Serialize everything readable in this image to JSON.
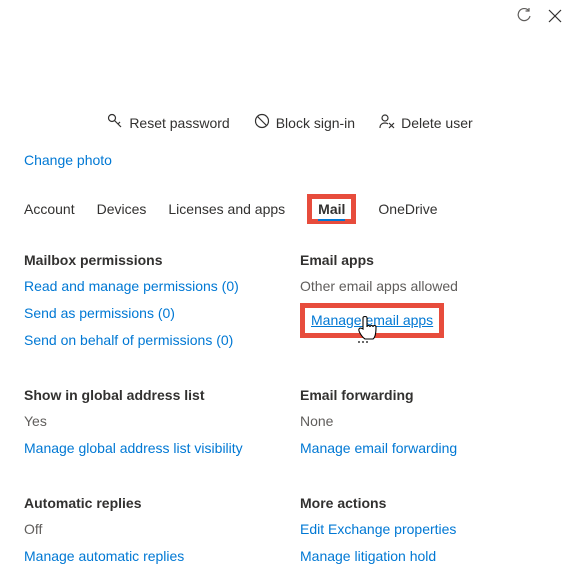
{
  "top": {
    "refresh": "Refresh",
    "close": "Close"
  },
  "actions": {
    "reset_password": "Reset password",
    "block_signin": "Block sign-in",
    "delete_user": "Delete user"
  },
  "change_photo": "Change photo",
  "tabs": {
    "account": "Account",
    "devices": "Devices",
    "licenses": "Licenses and apps",
    "mail": "Mail",
    "onedrive": "OneDrive"
  },
  "sections": {
    "mailbox_permissions": {
      "title": "Mailbox permissions",
      "read_manage": "Read and manage permissions (0)",
      "send_as": "Send as permissions (0)",
      "send_behalf": "Send on behalf of permissions (0)"
    },
    "email_apps": {
      "title": "Email apps",
      "status": "Other email apps allowed",
      "manage": "Manage email apps"
    },
    "global_address": {
      "title": "Show in global address list",
      "value": "Yes",
      "manage": "Manage global address list visibility"
    },
    "email_forwarding": {
      "title": "Email forwarding",
      "value": "None",
      "manage": "Manage email forwarding"
    },
    "automatic_replies": {
      "title": "Automatic replies",
      "value": "Off",
      "manage": "Manage automatic replies"
    },
    "more_actions": {
      "title": "More actions",
      "edit_exchange": "Edit Exchange properties",
      "litigation": "Manage litigation hold"
    }
  }
}
